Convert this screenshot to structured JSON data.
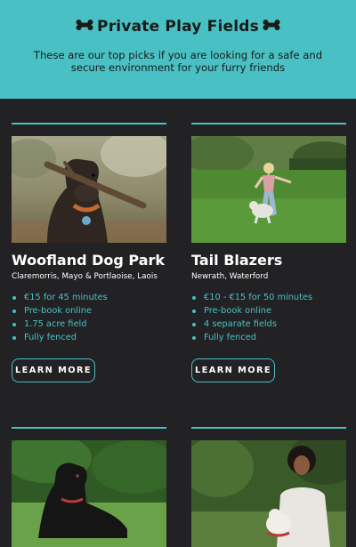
{
  "header": {
    "title": "Private Play Fields",
    "subtitle": "These are our top picks if you are looking for a safe and secure environment for your furry friends",
    "icon": "bone-icon"
  },
  "colors": {
    "accent": "#49c0c3",
    "background": "#222224",
    "text": "#ffffff"
  },
  "cards": [
    {
      "name": "Woofland Dog Park",
      "location": "Claremorris, Mayo & Portlaoise, Laois",
      "features": [
        "€15 for 45 minutes",
        "Pre-book online",
        "1.75 acre field",
        "Fully fenced"
      ],
      "button": "LEARN MORE"
    },
    {
      "name": "Tail Blazers",
      "location": "Newrath, Waterford",
      "features": [
        "€10 - €15 for 50 minutes",
        "Pre-book online",
        "4 separate fields",
        "Fully fenced"
      ],
      "button": "LEARN MORE"
    },
    {},
    {}
  ]
}
